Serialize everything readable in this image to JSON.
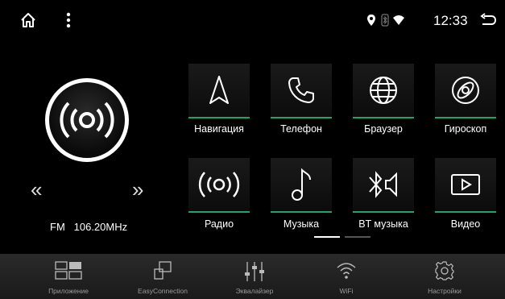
{
  "status": {
    "time": "12:33"
  },
  "radio": {
    "band": "FM",
    "frequency": "106.20MHz",
    "prev_symbol": "«",
    "next_symbol": "»"
  },
  "apps": [
    {
      "label": "Навигация",
      "icon": "navigation-icon"
    },
    {
      "label": "Телефон",
      "icon": "phone-icon"
    },
    {
      "label": "Браузер",
      "icon": "globe-icon"
    },
    {
      "label": "Гироскоп",
      "icon": "gyroscope-icon"
    },
    {
      "label": "Радио",
      "icon": "radio-icon"
    },
    {
      "label": "Музыка",
      "icon": "music-note-icon"
    },
    {
      "label": "BT музыка",
      "icon": "bluetooth-audio-icon"
    },
    {
      "label": "Видео",
      "icon": "video-play-icon"
    }
  ],
  "pager": {
    "pages": 2,
    "current": 1
  },
  "dock": [
    {
      "label": "Приложение",
      "icon": "apps-grid-icon"
    },
    {
      "label": "EasyConnection",
      "icon": "easy-connection-icon"
    },
    {
      "label": "Эквалайзер",
      "icon": "equalizer-icon"
    },
    {
      "label": "WiFi",
      "icon": "wifi-icon"
    },
    {
      "label": "Настройки",
      "icon": "settings-gear-icon"
    }
  ],
  "colors": {
    "accent": "#1fa46a",
    "dock_bg": "#222222",
    "label_gray": "#9a9a9a"
  }
}
